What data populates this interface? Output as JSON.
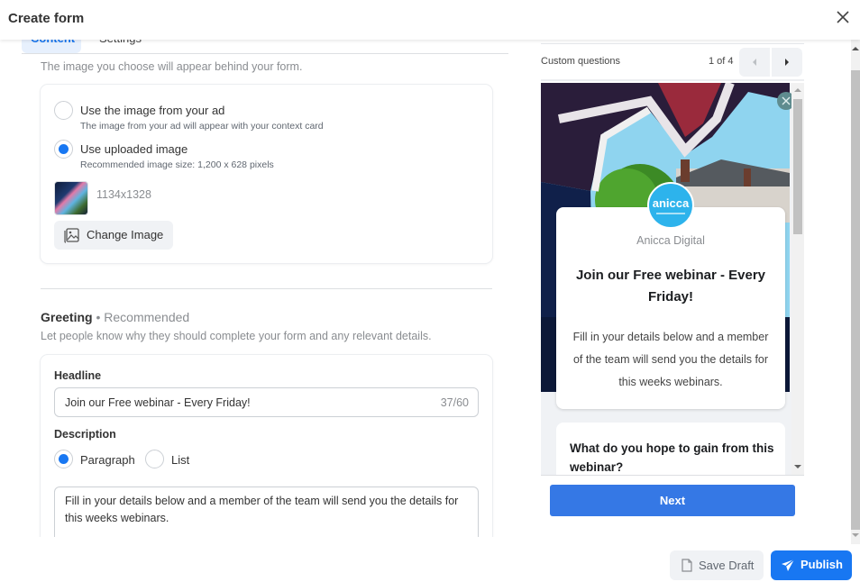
{
  "header": {
    "title": "Create form",
    "close_icon": "close-icon"
  },
  "tabs": [
    {
      "label": "Content",
      "active": true
    },
    {
      "label": "Settings",
      "active": false
    }
  ],
  "background_image": {
    "intro": "The image you choose will appear behind your form.",
    "options": [
      {
        "label": "Use the image from your ad",
        "sublabel": "The image from your ad will appear with your context card",
        "selected": false
      },
      {
        "label": "Use uploaded image",
        "sublabel": "Recommended image size: 1,200 x 628 pixels",
        "selected": true
      }
    ],
    "uploaded_dimensions": "1134x1328",
    "change_button": "Change Image"
  },
  "greeting": {
    "title": "Greeting",
    "badge": " • Recommended",
    "subtitle": "Let people know why they should complete your form and any relevant details.",
    "headline_label": "Headline",
    "headline_value": "Join our Free webinar - Every Friday!",
    "headline_count": "37/60",
    "description_label": "Description",
    "description_types": [
      {
        "label": "Paragraph",
        "selected": true
      },
      {
        "label": "List",
        "selected": false
      }
    ],
    "description_value": "Fill in your details below and a member of the team will send you the details for this weeks webinars."
  },
  "preview": {
    "section_label": "Custom questions",
    "page_indicator": "1 of 4",
    "brand_logo_text": "anicca",
    "brand_name": "Anicca Digital",
    "headline": "Join our Free webinar - Every Friday!",
    "description": "Fill in your details below and a member of the team will send you the details for this weeks webinars.",
    "question": "What do you hope to gain from this webinar?",
    "next_button": "Next"
  },
  "footer": {
    "save_draft": "Save Draft",
    "publish": "Publish"
  },
  "colors": {
    "accent": "#1877f2",
    "next_button": "#3578e5",
    "logo": "#2db3ec"
  }
}
